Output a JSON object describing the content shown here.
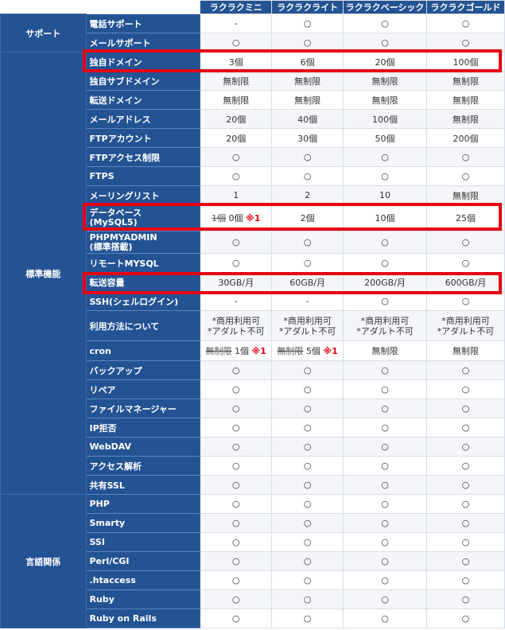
{
  "plans": [
    "ラクラクミニ",
    "ラクラクライト",
    "ラクラクベーシック",
    "ラクラクゴールド"
  ],
  "categories": {
    "support": "サポート",
    "standard": "標準機能",
    "language": "言語関係"
  },
  "rows": [
    {
      "feature": "電話サポート",
      "values": [
        "-",
        "○",
        "○",
        "○"
      ]
    },
    {
      "feature": "メールサポート",
      "values": [
        "○",
        "○",
        "○",
        "○"
      ]
    },
    {
      "feature": "独自ドメイン",
      "values": [
        "3個",
        "6個",
        "20個",
        "100個"
      ]
    },
    {
      "feature": "独自サブドメイン",
      "values": [
        "無制限",
        "無制限",
        "無制限",
        "無制限"
      ]
    },
    {
      "feature": "転送ドメイン",
      "values": [
        "無制限",
        "無制限",
        "無制限",
        "無制限"
      ]
    },
    {
      "feature": "メールアドレス",
      "values": [
        "20個",
        "40個",
        "100個",
        "無制限"
      ]
    },
    {
      "feature": "FTPアカウント",
      "values": [
        "20個",
        "30個",
        "50個",
        "200個"
      ]
    },
    {
      "feature": "FTPアクセス制限",
      "values": [
        "○",
        "○",
        "○",
        "○"
      ]
    },
    {
      "feature": "FTPS",
      "values": [
        "○",
        "○",
        "○",
        "○"
      ]
    },
    {
      "feature": "メーリングリスト",
      "values": [
        "1",
        "2",
        "10",
        "無制限"
      ]
    },
    {
      "feature": "データベース",
      "feature2": "(MySQL5)",
      "values": [
        "",
        "2個",
        "10個",
        "25個"
      ],
      "special": {
        "struck": "1個",
        "value": "0個",
        "note": "※1"
      }
    },
    {
      "feature": "PHPMYADMIN",
      "feature2": "(標準搭載)",
      "values": [
        "○",
        "○",
        "○",
        "○"
      ]
    },
    {
      "feature": "リモートMYSQL",
      "values": [
        "○",
        "○",
        "○",
        "○"
      ]
    },
    {
      "feature": "転送容量",
      "values": [
        "30GB/月",
        "60GB/月",
        "200GB/月",
        "600GB/月"
      ]
    },
    {
      "feature": "SSH(シェルログイン)",
      "values": [
        "-",
        "-",
        "○",
        "○"
      ]
    },
    {
      "feature": "利用方法について",
      "values": [
        "*商用利用可",
        "*商用利用可",
        "*商用利用可",
        "*商用利用可"
      ],
      "values2": [
        "*アダルト不可",
        "*アダルト不可",
        "*アダルト不可",
        "*アダルト不可"
      ]
    },
    {
      "feature": "cron",
      "values": [
        "",
        "",
        "無制限",
        "無制限"
      ],
      "special": [
        {
          "struck": "無制限",
          "value": "1個",
          "note": "※1"
        },
        {
          "struck": "無制限",
          "value": "5個",
          "note": "※1"
        }
      ]
    },
    {
      "feature": "バックアップ",
      "values": [
        "○",
        "○",
        "○",
        "○"
      ]
    },
    {
      "feature": "リペア",
      "values": [
        "○",
        "○",
        "○",
        "○"
      ]
    },
    {
      "feature": "ファイルマネージャー",
      "values": [
        "○",
        "○",
        "○",
        "○"
      ]
    },
    {
      "feature": "IP拒否",
      "values": [
        "○",
        "○",
        "○",
        "○"
      ]
    },
    {
      "feature": "WebDAV",
      "values": [
        "○",
        "○",
        "○",
        "○"
      ]
    },
    {
      "feature": "アクセス解析",
      "values": [
        "○",
        "○",
        "○",
        "○"
      ]
    },
    {
      "feature": "共有SSL",
      "values": [
        "○",
        "○",
        "○",
        "○"
      ]
    },
    {
      "feature": "PHP",
      "values": [
        "○",
        "○",
        "○",
        "○"
      ]
    },
    {
      "feature": "Smarty",
      "values": [
        "○",
        "○",
        "○",
        "○"
      ]
    },
    {
      "feature": "SSI",
      "values": [
        "○",
        "○",
        "○",
        "○"
      ]
    },
    {
      "feature": "Perl/CGI",
      "values": [
        "○",
        "○",
        "○",
        "○"
      ]
    },
    {
      "feature": ".htaccess",
      "values": [
        "○",
        "○",
        "○",
        "○"
      ]
    },
    {
      "feature": "Ruby",
      "values": [
        "○",
        "○",
        "○",
        "○"
      ]
    },
    {
      "feature": "Ruby on Rails",
      "values": [
        "○",
        "○",
        "○",
        "○"
      ]
    }
  ],
  "highlight_color": "#e60012",
  "header_color": "#245394"
}
